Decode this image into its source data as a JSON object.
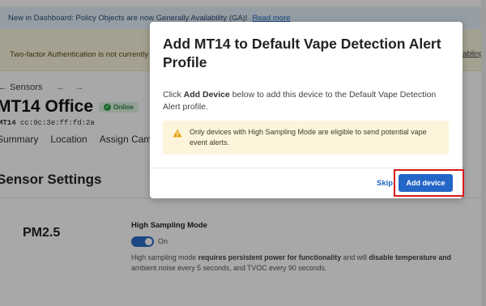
{
  "banner": {
    "text": "New in Dashboard: Policy Objects are now Generally Availability (GA)!",
    "link": "Read more"
  },
  "warning_bar": {
    "text": "Two-factor Authentication is not currently",
    "right_link": "nabling it"
  },
  "breadcrumb": {
    "back": "← Sensors",
    "nav_arrows": "←→"
  },
  "device": {
    "name": "MT14 Office",
    "status": "Online",
    "mac_prefix": "MT14",
    "mac": "cc:9c:3e:ff:fd:2a"
  },
  "tabs": [
    "Summary",
    "Location",
    "Assign Cam"
  ],
  "section_title": "Sensor Settings",
  "pm25": {
    "label": "PM2.5",
    "setting_title": "High Sampling Mode",
    "toggle_label": "On",
    "desc_1": "High sampling mode ",
    "desc_b1": "requires persistent power for functionality",
    "desc_2": " and will ",
    "desc_b2": "disable temperature and",
    "desc_3": "ambient noise every 5 seconds, and TVOC every 90 seconds."
  },
  "modal": {
    "title": "Add MT14 to Default Vape Detection Alert Profile",
    "body_1": "Click ",
    "body_b": "Add Device",
    "body_2": " below to add this device to the Default Vape Detection Alert profile.",
    "alert": "Only devices with High Sampling Mode are eligible to send potential vape event alerts.",
    "skip": "Skip",
    "add": "Add device"
  },
  "colors": {
    "accent": "#2366c7",
    "highlight": "#d61a1a",
    "alert_bg": "#fdf5db",
    "online": "#2e9d4b"
  }
}
